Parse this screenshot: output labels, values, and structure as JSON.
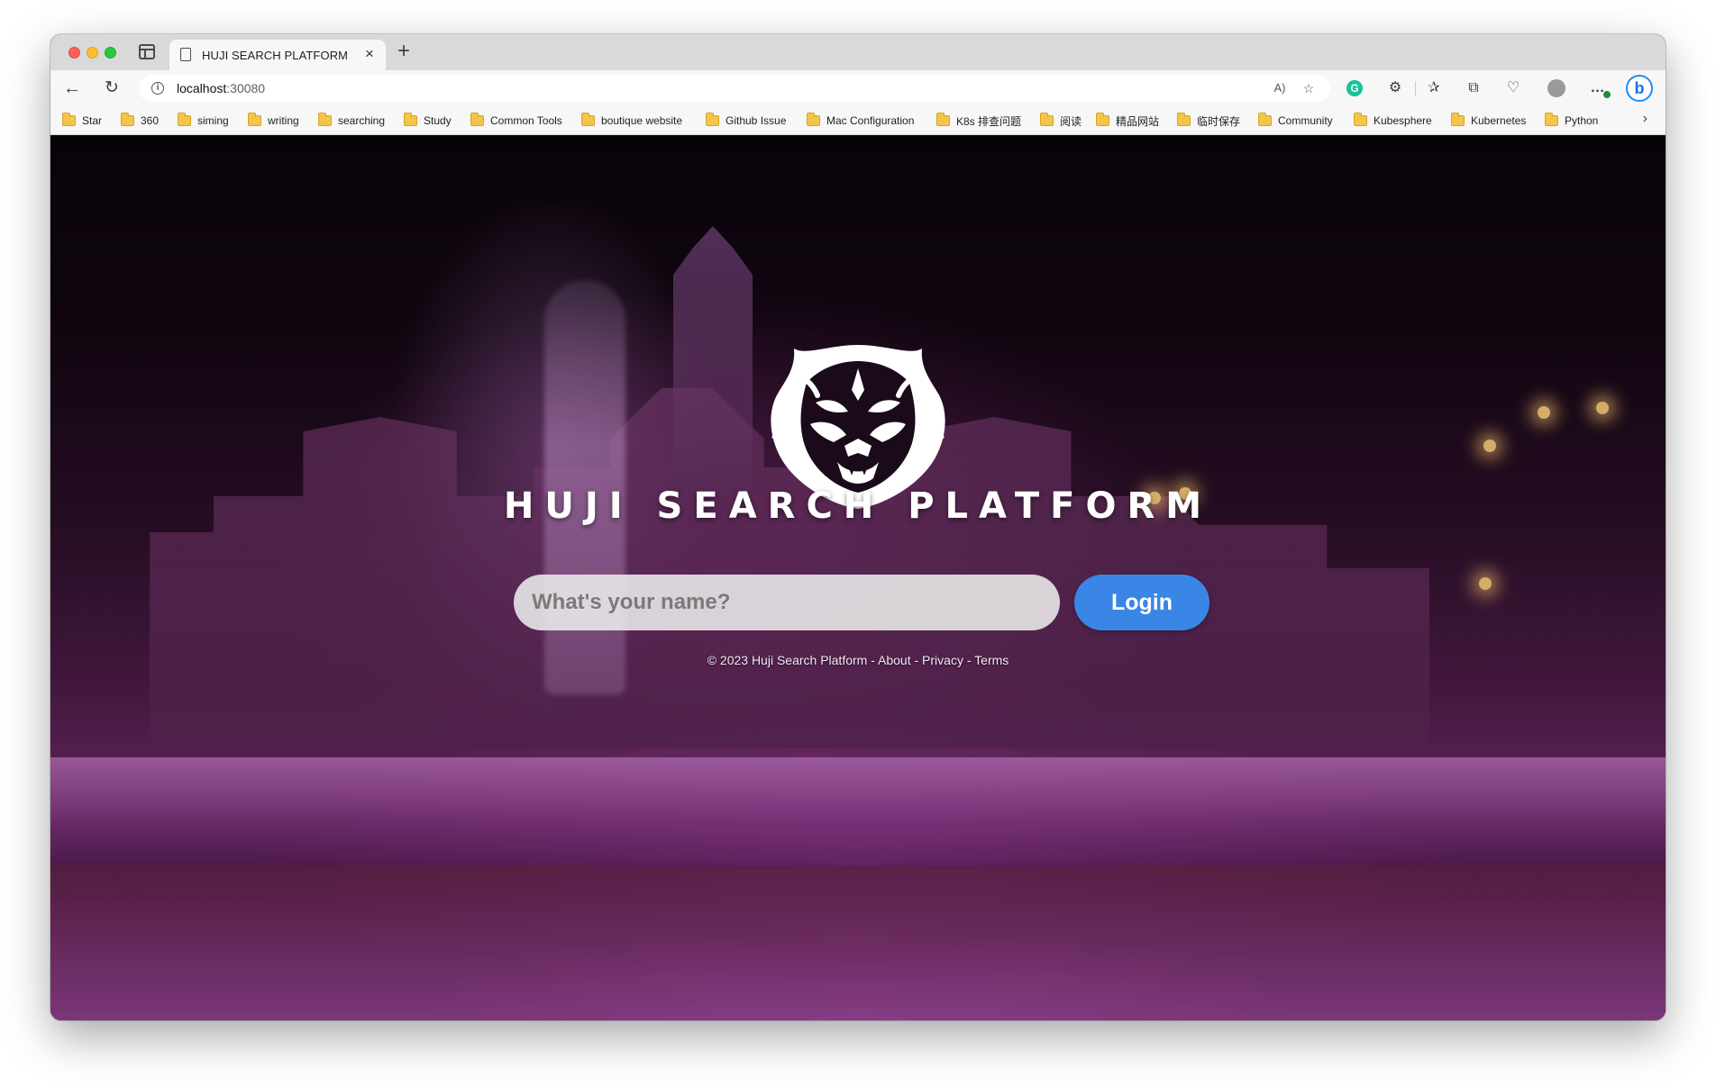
{
  "browser": {
    "tab_title": "HUJI SEARCH PLATFORM",
    "url_host": "localhost",
    "url_port": ":30080",
    "read_aloud_glyph": "A)",
    "more_glyph": "…",
    "copilot_glyph": "b"
  },
  "bookmarks": [
    {
      "label": "Star"
    },
    {
      "label": "360"
    },
    {
      "label": "siming"
    },
    {
      "label": "writing"
    },
    {
      "label": "searching"
    },
    {
      "label": "Study"
    },
    {
      "label": "Common Tools"
    },
    {
      "label": "boutique website"
    },
    {
      "label": "Github Issue"
    },
    {
      "label": "Mac Configuration"
    },
    {
      "label": "K8s 排查问题"
    },
    {
      "label": "阅读"
    },
    {
      "label": "精品网站"
    },
    {
      "label": "临时保存"
    },
    {
      "label": "Community"
    },
    {
      "label": "Kubesphere"
    },
    {
      "label": "Kubernetes"
    },
    {
      "label": "Python"
    }
  ],
  "page": {
    "brand_title": "HUJI SEARCH PLATFORM",
    "name_placeholder": "What's your name?",
    "login_label": "Login",
    "footer": {
      "copyright": "© 2023 Huji Search Platform",
      "sep1": " - ",
      "about": "About",
      "sep2": " - ",
      "privacy": "Privacy",
      "sep3": " - ",
      "terms": "Terms"
    }
  },
  "colors": {
    "login_button": "#3a86e6",
    "tab_strip": "#d9d9d9",
    "toolbar": "#f7f7f7"
  }
}
